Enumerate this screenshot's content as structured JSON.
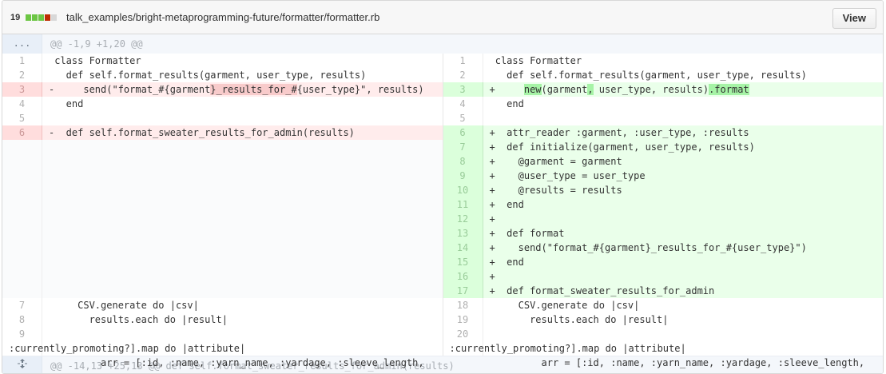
{
  "header": {
    "stat_count": "19",
    "stat_colors": [
      "#6cc644",
      "#6cc644",
      "#6cc644",
      "#bd2c00",
      "#d8d8d8"
    ],
    "file_path": "talk_examples/bright-metaprogramming-future/formatter/formatter.rb",
    "view_label": "View"
  },
  "hunk_top": {
    "expander": "...",
    "text": "@@ -1,9 +1,20 @@"
  },
  "left": {
    "lines": [
      {
        "num": "1",
        "type": "ctx",
        "text": " class Formatter"
      },
      {
        "num": "2",
        "type": "ctx",
        "text": "   def self.format_results(garment, user_type, results)"
      },
      {
        "num": "3",
        "type": "del",
        "pre": "-     send(\"format_#{garment",
        "hl": "}_results_for_#",
        "post": "{user_type}\", results)"
      },
      {
        "num": "4",
        "type": "ctx",
        "text": "   end"
      },
      {
        "num": "5",
        "type": "ctx",
        "text": ""
      },
      {
        "num": "6",
        "type": "del",
        "text": "-  def self.format_sweater_results_for_admin(results)"
      }
    ],
    "tail": [
      {
        "num": "7",
        "text": "     CSV.generate do |csv|"
      },
      {
        "num": "8",
        "text": "       results.each do |result|"
      },
      {
        "num": "9",
        "text": "         arr = [:id, :name, :yarn_name, :yardage, :sleeve_length,",
        "text2": ":currently_promoting?].map do |attribute|"
      }
    ]
  },
  "right": {
    "lines": [
      {
        "num": "1",
        "type": "ctx",
        "text": " class Formatter"
      },
      {
        "num": "2",
        "type": "ctx",
        "text": "   def self.format_results(garment, user_type, results)"
      },
      {
        "num": "3",
        "type": "add",
        "pre": "+     ",
        "hl1": "new",
        "mid1": "(garment",
        "hl2": ",",
        "mid2": " user_type, results)",
        "hl3": ".format",
        "post": ""
      },
      {
        "num": "4",
        "type": "ctx",
        "text": "   end"
      },
      {
        "num": "5",
        "type": "ctx",
        "text": ""
      },
      {
        "num": "6",
        "type": "add",
        "text": "+  attr_reader :garment, :user_type, :results"
      },
      {
        "num": "7",
        "type": "add",
        "text": "+  def initialize(garment, user_type, results)"
      },
      {
        "num": "8",
        "type": "add",
        "text": "+    @garment = garment"
      },
      {
        "num": "9",
        "type": "add",
        "text": "+    @user_type = user_type"
      },
      {
        "num": "10",
        "type": "add",
        "text": "+    @results = results"
      },
      {
        "num": "11",
        "type": "add",
        "text": "+  end"
      },
      {
        "num": "12",
        "type": "add",
        "text": "+"
      },
      {
        "num": "13",
        "type": "add",
        "text": "+  def format"
      },
      {
        "num": "14",
        "type": "add",
        "text": "+    send(\"format_#{garment}_results_for_#{user_type}\")"
      },
      {
        "num": "15",
        "type": "add",
        "text": "+  end"
      },
      {
        "num": "16",
        "type": "add",
        "text": "+"
      },
      {
        "num": "17",
        "type": "add",
        "text": "+  def format_sweater_results_for_admin"
      }
    ],
    "tail": [
      {
        "num": "18",
        "text": "     CSV.generate do |csv|"
      },
      {
        "num": "19",
        "text": "       results.each do |result|"
      },
      {
        "num": "20",
        "text": "         arr = [:id, :name, :yarn_name, :yardage, :sleeve_length,",
        "text2": ":currently_promoting?].map do |attribute|"
      }
    ]
  },
  "hunk_bottom": {
    "expander_icon": "unfold-icon",
    "text": "@@ -14,13 +25,13 @@ def self.format_sweater_results_for_admin(results)"
  }
}
